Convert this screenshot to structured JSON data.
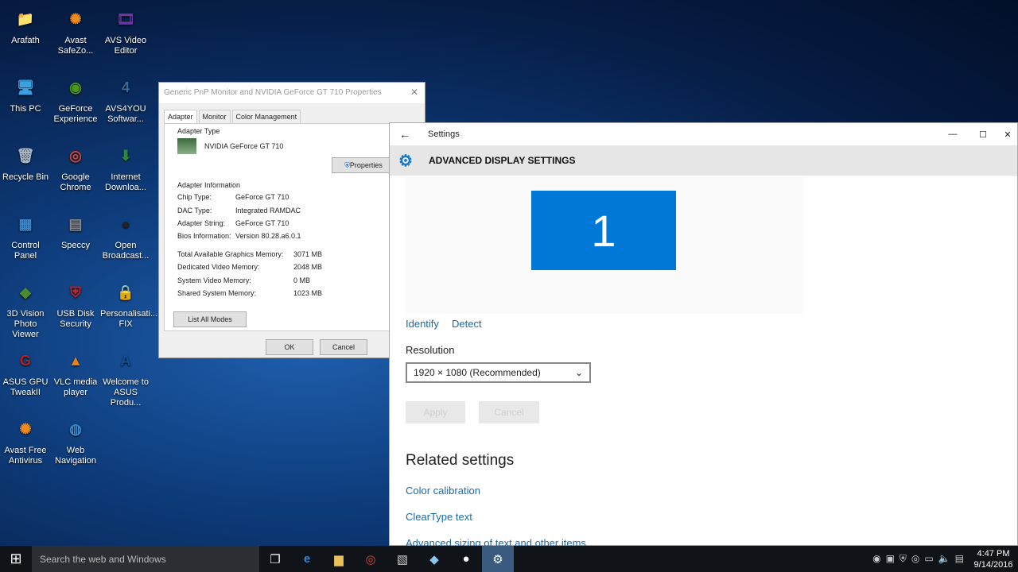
{
  "desktop_icons": [
    {
      "label": "Arafath",
      "glyph": "📁",
      "color": "#e8c15a"
    },
    {
      "label": "Avast SafeZo...",
      "glyph": "✺",
      "color": "#f08a1c"
    },
    {
      "label": "AVS Video Editor",
      "glyph": "🎞",
      "color": "#6a3aa0"
    },
    {
      "label": "This PC",
      "glyph": "🖥",
      "color": "#3aa0e0"
    },
    {
      "label": "GeForce Experience",
      "glyph": "◉",
      "color": "#4a9a20"
    },
    {
      "label": "AVS4YOU Softwar...",
      "glyph": "4",
      "color": "#3a6aa0"
    },
    {
      "label": "Recycle Bin",
      "glyph": "🗑",
      "color": "#aab8c8"
    },
    {
      "label": "Google Chrome",
      "glyph": "◎",
      "color": "#db4437"
    },
    {
      "label": "Internet Downloa...",
      "glyph": "⬇",
      "color": "#2a8a3a"
    },
    {
      "label": "Control Panel",
      "glyph": "▦",
      "color": "#3a8ad0"
    },
    {
      "label": "Speccy",
      "glyph": "▤",
      "color": "#8a8a8a"
    },
    {
      "label": "Open Broadcast...",
      "glyph": "●",
      "color": "#222"
    },
    {
      "label": "3D Vision Photo Viewer",
      "glyph": "◆",
      "color": "#4a8a30"
    },
    {
      "label": "USB Disk Security",
      "glyph": "⛨",
      "color": "#d02020"
    },
    {
      "label": "Personalisati... FIX",
      "glyph": "🔒",
      "color": "#d0a020"
    },
    {
      "label": "ASUS GPU TweakII",
      "glyph": "G",
      "color": "#b02020"
    },
    {
      "label": "VLC media player",
      "glyph": "▲",
      "color": "#f08010"
    },
    {
      "label": "Welcome to ASUS Produ...",
      "glyph": "A",
      "color": "#1050a0"
    },
    {
      "label": "Avast Free Antivirus",
      "glyph": "✺",
      "color": "#f08a1c"
    },
    {
      "label": "Web Navigation",
      "glyph": "◍",
      "color": "#3a8ad0"
    }
  ],
  "dialog": {
    "title": "Generic PnP Monitor and NVIDIA GeForce GT 710   Properties",
    "tabs": [
      "Adapter",
      "Monitor",
      "Color Management"
    ],
    "adapter_type_label": "Adapter Type",
    "adapter_name": "NVIDIA GeForce GT 710",
    "properties_button": "Properties",
    "info_label": "Adapter Information",
    "info": [
      {
        "k": "Chip Type:",
        "v": "GeForce GT 710"
      },
      {
        "k": "DAC Type:",
        "v": "Integrated RAMDAC"
      },
      {
        "k": "Adapter String:",
        "v": "GeForce GT 710"
      },
      {
        "k": "Bios Information:",
        "v": "Version 80.28.a6.0.1"
      }
    ],
    "memory": [
      {
        "k": "Total Available Graphics Memory:",
        "v": "3071 MB"
      },
      {
        "k": "Dedicated Video Memory:",
        "v": "2048 MB"
      },
      {
        "k": "System Video Memory:",
        "v": "0 MB"
      },
      {
        "k": "Shared System Memory:",
        "v": "1023 MB"
      }
    ],
    "list_modes": "List All Modes",
    "ok": "OK",
    "cancel": "Cancel"
  },
  "settings": {
    "app_title": "Settings",
    "page_title": "ADVANCED DISPLAY SETTINGS",
    "monitor_number": "1",
    "identify": "Identify",
    "detect": "Detect",
    "resolution_label": "Resolution",
    "resolution_value": "1920 × 1080 (Recommended)",
    "apply": "Apply",
    "cancel": "Cancel",
    "related_heading": "Related settings",
    "related_links": [
      "Color calibration",
      "ClearType text",
      "Advanced sizing of text and other items"
    ],
    "accent": "#0078d7"
  },
  "taskbar": {
    "search_placeholder": "Search the web and Windows",
    "time": "4:47 PM",
    "date": "9/14/2016"
  }
}
